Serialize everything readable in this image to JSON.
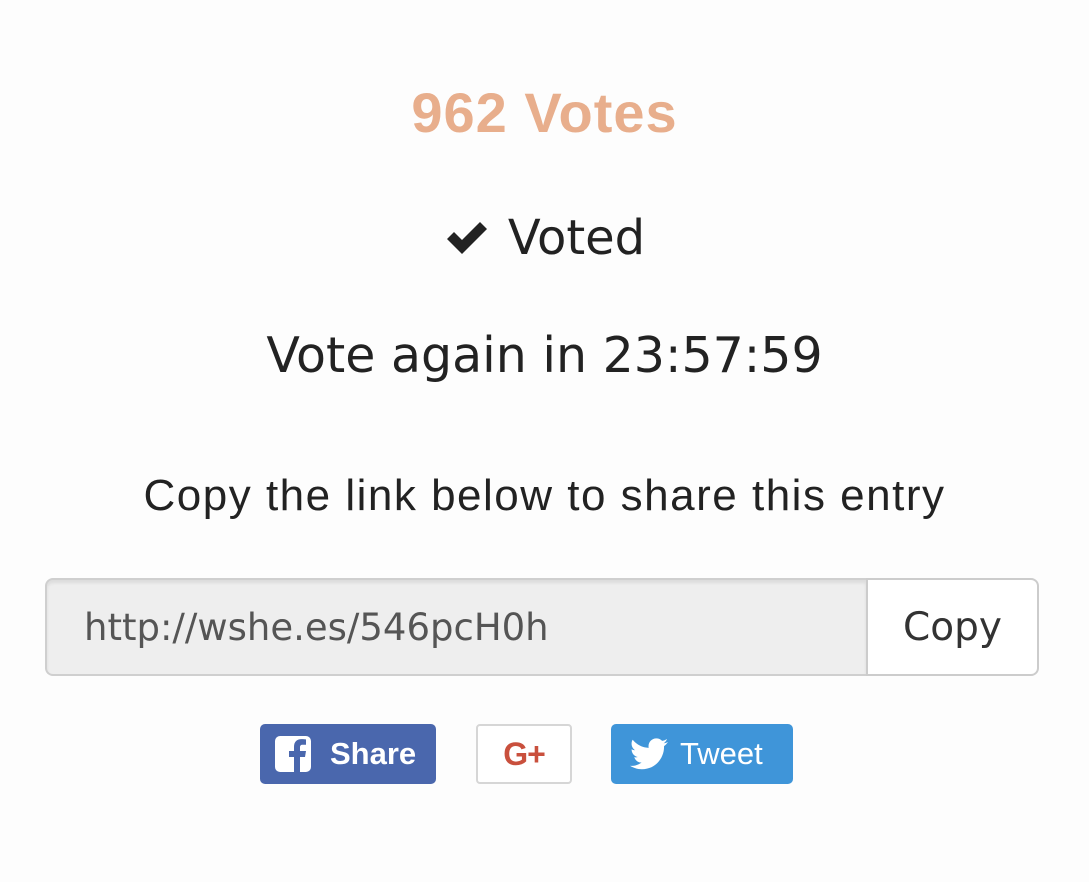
{
  "votes": {
    "count_label": "962 Votes",
    "color": "#e8ae8c"
  },
  "status": {
    "icon": "check-icon",
    "label": "Voted"
  },
  "countdown": {
    "label": "Vote again in 23:57:59"
  },
  "share": {
    "instructions": "Copy the link below to share this entry",
    "link_value": "http://wshe.es/546pcH0h",
    "copy_label": "Copy"
  },
  "social": {
    "facebook": {
      "icon": "facebook-icon",
      "label": "Share",
      "color": "#4a67ad"
    },
    "google_plus": {
      "icon": "google-plus-icon",
      "label": "G+",
      "color": "#c9503d"
    },
    "twitter": {
      "icon": "twitter-bird-icon",
      "label": "Tweet",
      "color": "#3f95d9"
    }
  }
}
